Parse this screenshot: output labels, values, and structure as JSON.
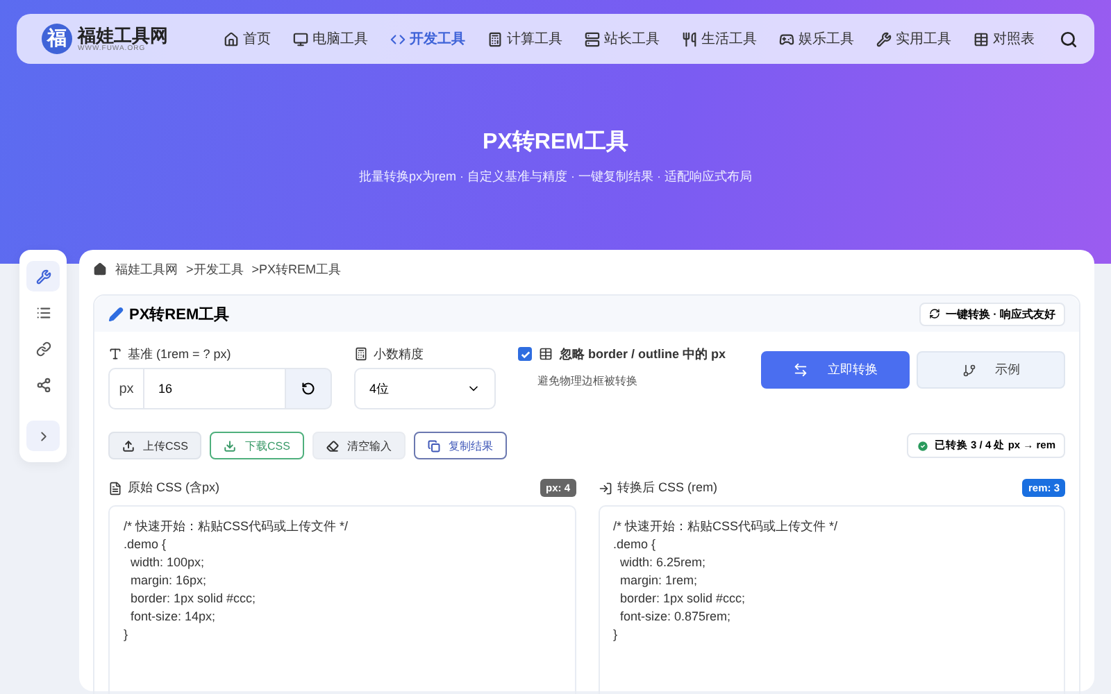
{
  "header": {
    "logo_mark": "福",
    "site_name": "福娃工具网",
    "site_url": "WWW.FUWA.ORG",
    "nav": [
      {
        "label": "首页",
        "selected": false
      },
      {
        "label": "电脑工具",
        "selected": false
      },
      {
        "label": "开发工具",
        "selected": true
      },
      {
        "label": "计算工具",
        "selected": false
      },
      {
        "label": "站长工具",
        "selected": false
      },
      {
        "label": "生活工具",
        "selected": false
      },
      {
        "label": "娱乐工具",
        "selected": false
      },
      {
        "label": "实用工具",
        "selected": false
      },
      {
        "label": "对照表",
        "selected": false
      }
    ]
  },
  "hero": {
    "title": "PX转REM工具",
    "subtitle": "批量转换px为rem · 自定义基准与精度 · 一键复制结果 · 适配响应式布局"
  },
  "sidebar": {
    "items": [
      {
        "selected": true
      },
      {
        "selected": false
      },
      {
        "selected": false
      },
      {
        "selected": false
      }
    ]
  },
  "breadcrumb": [
    "福娃工具网",
    ">开发工具",
    ">PX转REM工具"
  ],
  "panel": {
    "title": "PX转REM工具",
    "badge": "一键转换 · 响应式友好",
    "base": {
      "label": "基准 (1rem = ? px)",
      "prefix": "px",
      "value": "16"
    },
    "precision": {
      "label": "小数精度",
      "value": "4位"
    },
    "ignore": {
      "checked": true,
      "label": "忽略 border / outline 中的 px",
      "hint": "避免物理边框被转换"
    },
    "convert_button": "立即转换",
    "example_button": "示例",
    "actions": [
      "上传CSS",
      "下载CSS",
      "清空输入",
      "复制结果"
    ],
    "status": "已转换 3 / 4 处 px → rem",
    "input": {
      "title": "原始 CSS (含px)",
      "count": "px: 4",
      "code": "/* 快速开始：粘贴CSS代码或上传文件 */\n.demo {\n  width: 100px;\n  margin: 16px;\n  border: 1px solid #ccc;\n  font-size: 14px;\n}"
    },
    "output": {
      "title": "转换后 CSS (rem)",
      "count": "rem: 3",
      "code": "/* 快速开始：粘贴CSS代码或上传文件 */\n.demo {\n  width: 6.25rem;\n  margin: 1rem;\n  border: 1px solid #ccc;\n  font-size: 0.875rem;\n}"
    }
  }
}
